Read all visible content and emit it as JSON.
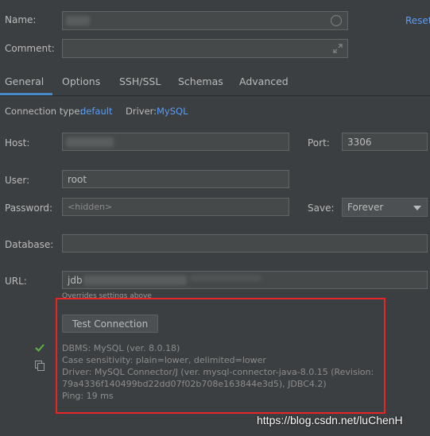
{
  "form": {
    "name_label": "Name:",
    "reset_label": "Reset",
    "comment_label": "Comment:"
  },
  "tabs": [
    {
      "label": "General"
    },
    {
      "label": "Options"
    },
    {
      "label": "SSH/SSL"
    },
    {
      "label": "Schemas"
    },
    {
      "label": "Advanced"
    }
  ],
  "connection": {
    "type_label": "Connection type:",
    "type_value": "default",
    "driver_label": "Driver:",
    "driver_value": "MySQL"
  },
  "host_label": "Host:",
  "port_label": "Port:",
  "port_value": "3306",
  "user_label": "User:",
  "user_value": "root",
  "password_label": "Password:",
  "password_placeholder": "<hidden>",
  "save_label": "Save:",
  "save_value": "Forever",
  "database_label": "Database:",
  "url_label": "URL:",
  "url_prefix": "jdb",
  "url_note": "Overrides settings above",
  "test_button_label": "Test Connection",
  "result": {
    "dbms": "DBMS: MySQL (ver. 8.0.18)",
    "case": "Case sensitivity: plain=lower, delimited=lower",
    "driver_line1": "Driver: MySQL Connector/J (ver. mysql-connector-java-8.0.15 (Revision:",
    "driver_line2": "79a4336f140499bd22dd07f02b708e163844e3d5), JDBC4.2)",
    "ping": "Ping: 19 ms"
  },
  "watermark": "https://blog.csdn.net/luChenH",
  "colors": {
    "background": "#3c3f41",
    "field": "#45494a",
    "link": "#589df6",
    "highlight_box": "#e82525",
    "success": "#5fb244"
  }
}
